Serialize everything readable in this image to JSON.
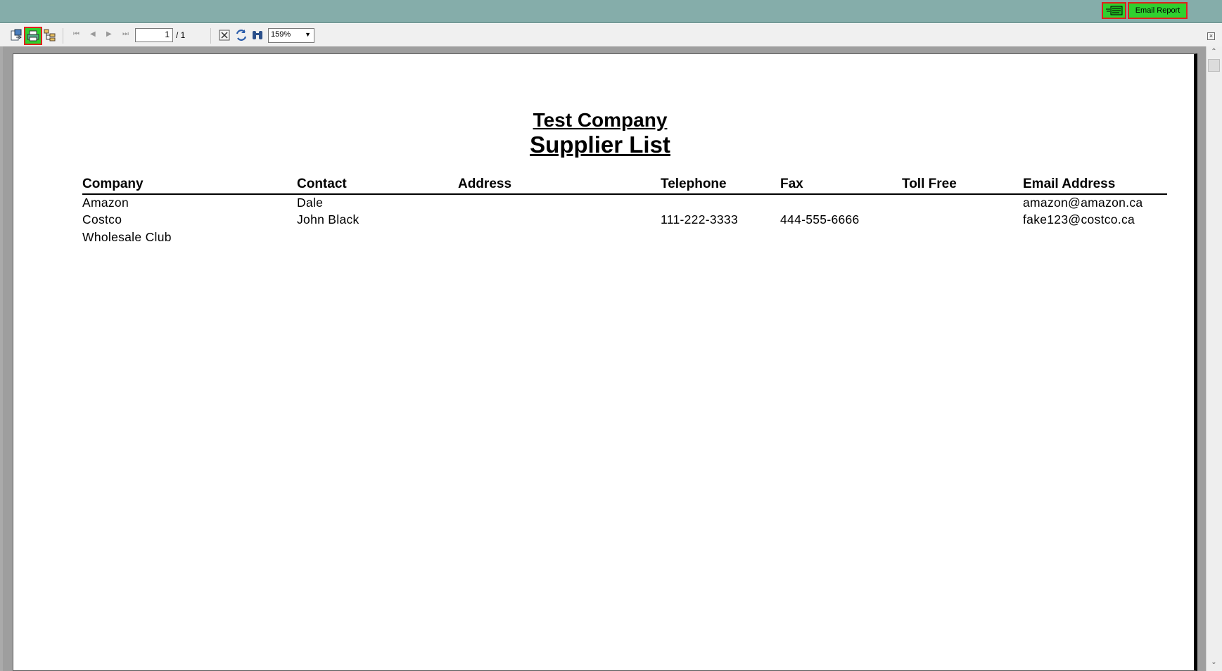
{
  "topbar": {
    "email_icon": "email-send-icon",
    "email_report_label": "Email Report",
    "highlight_color": "#2fd12f",
    "border_color": "#e0201c"
  },
  "toolbar": {
    "icons": [
      "export-icon",
      "print-icon",
      "group-tree-icon",
      "first-page-icon",
      "previous-page-icon",
      "next-page-icon",
      "last-page-icon",
      "close-view-icon",
      "refresh-icon",
      "search-text-icon"
    ],
    "current_page": "1",
    "page_total": "/ 1",
    "zoom": "159%"
  },
  "report": {
    "company_title": "Test Company",
    "report_title": "Supplier List",
    "columns": [
      "Company",
      "Contact",
      "Address",
      "Telephone",
      "Fax",
      "Toll Free",
      "Email Address"
    ],
    "rows": [
      {
        "company": "Amazon",
        "contact": "Dale",
        "address": "",
        "telephone": "",
        "fax": "",
        "toll_free": "",
        "email": "amazon@amazon.ca"
      },
      {
        "company": "Costco",
        "contact": "John Black",
        "address": "",
        "telephone": "111-222-3333",
        "fax": "444-555-6666",
        "toll_free": "",
        "email": "fake123@costco.ca"
      },
      {
        "company": "Wholesale Club",
        "contact": "",
        "address": "",
        "telephone": "",
        "fax": "",
        "toll_free": "",
        "email": ""
      }
    ]
  }
}
